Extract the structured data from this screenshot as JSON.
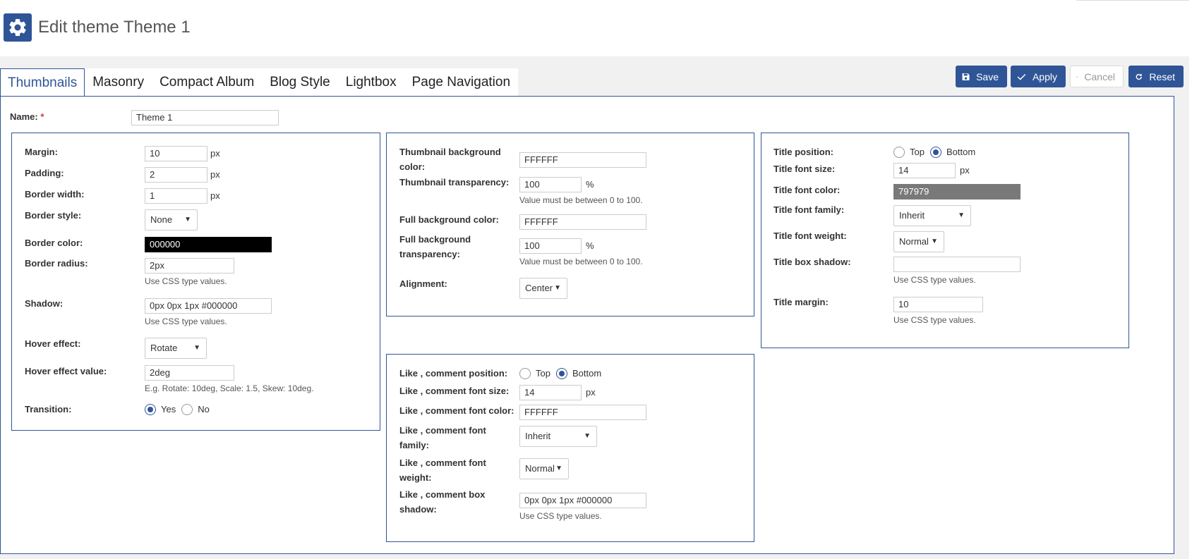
{
  "header": {
    "title": "Edit theme Theme 1",
    "icon": "gear-icon",
    "accent": "#2f5597"
  },
  "tabs": [
    {
      "label": "Thumbnails",
      "active": true
    },
    {
      "label": "Masonry"
    },
    {
      "label": "Compact Album"
    },
    {
      "label": "Blog Style"
    },
    {
      "label": "Lightbox"
    },
    {
      "label": "Page Navigation"
    }
  ],
  "toolbar": {
    "save": "Save",
    "apply": "Apply",
    "cancel": "Cancel",
    "reset": "Reset"
  },
  "name_field": {
    "label": "Name:",
    "required": "*",
    "value": "Theme 1"
  },
  "units": {
    "px": "px",
    "percent": "%"
  },
  "radio_labels": {
    "top": "Top",
    "bottom": "Bottom",
    "yes": "Yes",
    "no": "No"
  },
  "hints": {
    "css": "Use CSS type values.",
    "range": "Value must be between 0 to 100.",
    "hover": "E.g. Rotate: 10deg, Scale: 1.5, Skew: 10deg."
  },
  "thumb": {
    "margin": {
      "label": "Margin:",
      "value": "10"
    },
    "padding": {
      "label": "Padding:",
      "value": "2"
    },
    "border_width": {
      "label": "Border width:",
      "value": "1"
    },
    "border_style": {
      "label": "Border style:",
      "value": "None"
    },
    "border_color": {
      "label": "Border color:",
      "value": "000000"
    },
    "border_radius": {
      "label": "Border radius:",
      "value": "2px"
    },
    "shadow": {
      "label": "Shadow:",
      "value": "0px 0px 1px #000000"
    },
    "hover_effect": {
      "label": "Hover effect:",
      "value": "Rotate"
    },
    "hover_effect_value": {
      "label": "Hover effect value:",
      "value": "2deg"
    },
    "transition": {
      "label": "Transition:",
      "selected": "Yes"
    }
  },
  "background": {
    "thumb_bg_color": {
      "label1": "Thumbnail background",
      "label2": "color:",
      "value": "FFFFFF"
    },
    "thumb_transparency": {
      "label": "Thumbnail transparency:",
      "value": "100"
    },
    "full_bg_color": {
      "label": "Full background color:",
      "value": "FFFFFF"
    },
    "full_bg_transparency": {
      "label1": "Full background",
      "label2": "transparency:",
      "value": "100"
    },
    "alignment": {
      "label": "Alignment:",
      "value": "Center"
    }
  },
  "like": {
    "position": {
      "label": "Like , comment position:",
      "selected": "Bottom"
    },
    "font_size": {
      "label": "Like , comment font size:",
      "value": "14"
    },
    "font_color": {
      "label": "Like , comment font color:",
      "value": "FFFFFF"
    },
    "font_family": {
      "label1": "Like , comment font",
      "label2": "family:",
      "value": "Inherit"
    },
    "font_weight": {
      "label1": "Like , comment font",
      "label2": "weight:",
      "value": "Normal"
    },
    "box_shadow": {
      "label1": "Like , comment box",
      "label2": "shadow:",
      "value": "0px 0px 1px #000000"
    }
  },
  "title": {
    "position": {
      "label": "Title position:",
      "selected": "Bottom"
    },
    "font_size": {
      "label": "Title font size:",
      "value": "14"
    },
    "font_color": {
      "label": "Title font color:",
      "value": "797979"
    },
    "font_family": {
      "label": "Title font family:",
      "value": "Inherit"
    },
    "font_weight": {
      "label": "Title font weight:",
      "value": "Normal"
    },
    "box_shadow": {
      "label": "Title box shadow:",
      "value": ""
    },
    "margin": {
      "label": "Title margin:",
      "value": "10"
    }
  }
}
